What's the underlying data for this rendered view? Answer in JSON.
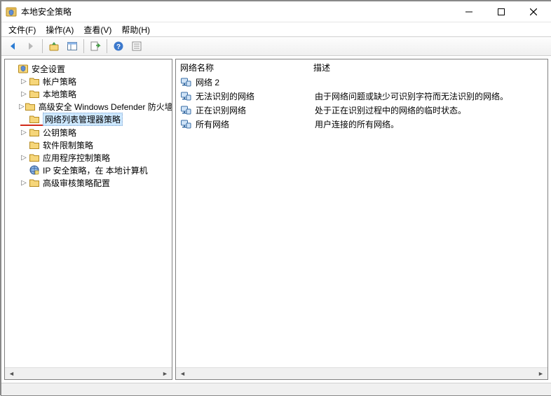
{
  "window": {
    "title": "本地安全策略"
  },
  "menu": {
    "file": "文件(F)",
    "action": "操作(A)",
    "view": "查看(V)",
    "help": "帮助(H)"
  },
  "tree": {
    "root": "安全设置",
    "items": [
      {
        "label": "帐户策略",
        "icon": "folder",
        "expandable": true
      },
      {
        "label": "本地策略",
        "icon": "folder",
        "expandable": true
      },
      {
        "label": "高级安全 Windows Defender 防火墙",
        "icon": "folder",
        "expandable": true
      },
      {
        "label": "网络列表管理器策略",
        "icon": "folder",
        "expandable": false,
        "selected": true
      },
      {
        "label": "公钥策略",
        "icon": "folder",
        "expandable": true
      },
      {
        "label": "软件限制策略",
        "icon": "folder",
        "expandable": false
      },
      {
        "label": "应用程序控制策略",
        "icon": "folder",
        "expandable": true
      },
      {
        "label": "IP 安全策略，在 本地计算机",
        "icon": "ipsec",
        "expandable": false
      },
      {
        "label": "高级审核策略配置",
        "icon": "folder",
        "expandable": true
      }
    ]
  },
  "list": {
    "col_name": "网络名称",
    "col_desc": "描述",
    "rows": [
      {
        "name": "网络 2",
        "desc": ""
      },
      {
        "name": "无法识别的网络",
        "desc": "由于网络问题或缺少可识别字符而无法识别的网络。"
      },
      {
        "name": "正在识别网络",
        "desc": "处于正在识别过程中的网络的临时状态。"
      },
      {
        "name": "所有网络",
        "desc": "用户连接的所有网络。"
      }
    ]
  }
}
